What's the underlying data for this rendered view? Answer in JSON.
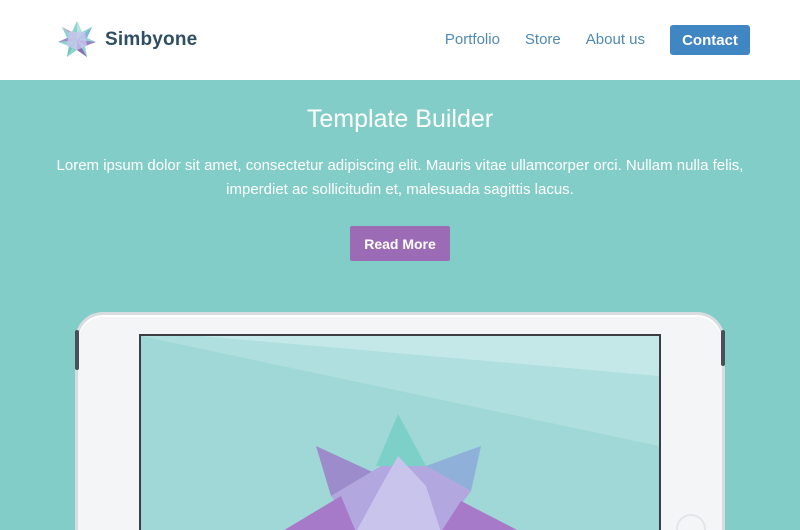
{
  "header": {
    "brand": "Simbyone",
    "logo_icon": "star-gem-icon",
    "nav": [
      {
        "label": "Portfolio"
      },
      {
        "label": "Store"
      },
      {
        "label": "About us"
      }
    ],
    "contact_label": "Contact"
  },
  "hero": {
    "title": "Template Builder",
    "text": "Lorem ipsum dolor sit amet, consectetur adipiscing elit. Mauris vitae ullamcorper orci. Nullam nulla felis, imperdiet ac sollicitudin et, malesuada sagittis lacus.",
    "button_label": "Read More"
  },
  "colors": {
    "background": "#82cdc7",
    "header_bg": "#ffffff",
    "brand_text": "#2e4f63",
    "nav_link": "#4f8ab2",
    "contact_button": "#3f86c3",
    "read_more_button": "#9b6bb6"
  }
}
